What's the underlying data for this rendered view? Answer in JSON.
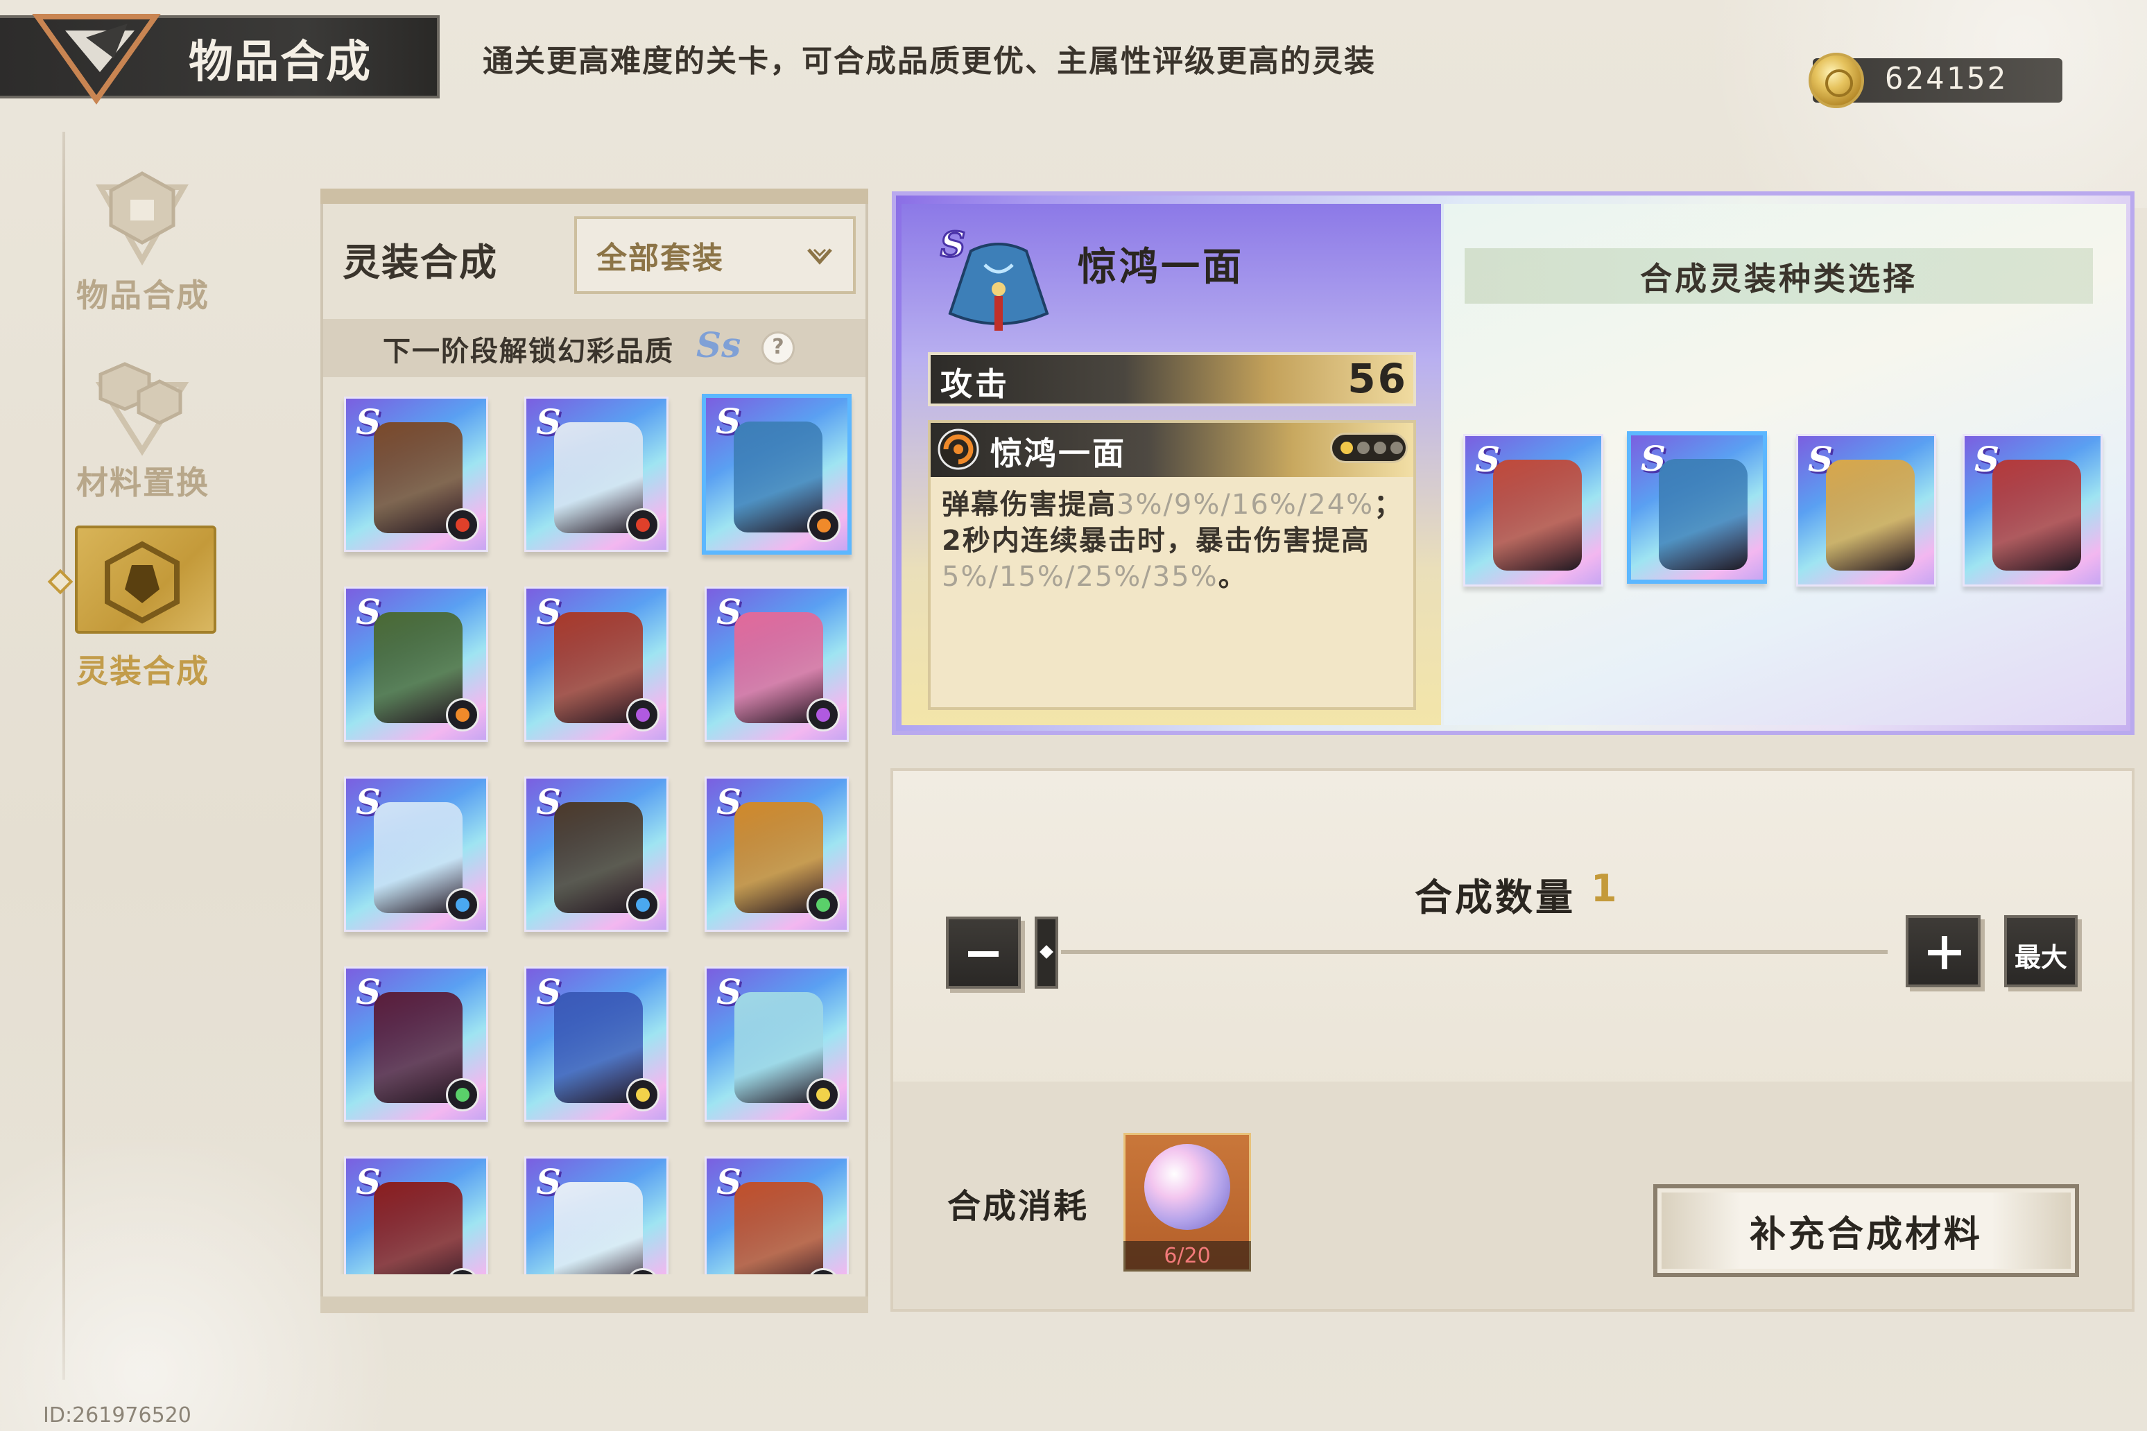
{
  "header": {
    "title": "物品合成",
    "tip": "通关更高难度的关卡，可合成品质更优、主属性评级更高的灵装",
    "currency_value": "624152",
    "currency_icon": "gold-coin-icon"
  },
  "nav": {
    "items": [
      {
        "label": "物品合成",
        "icon": "item-synthesis-icon",
        "active": false
      },
      {
        "label": "材料置换",
        "icon": "material-exchange-icon",
        "active": false
      },
      {
        "label": "灵装合成",
        "icon": "equipment-synthesis-icon",
        "active": true
      }
    ]
  },
  "list": {
    "title": "灵装合成",
    "filter": "全部套装",
    "unlock_text": "下一阶段解锁幻彩品质",
    "unlock_badge": "Ss",
    "items": [
      {
        "grade": "S",
        "item": "fur-collar-coat",
        "badge": "red-set-icon"
      },
      {
        "grade": "S",
        "item": "white-blue-cloak",
        "badge": "red-set-icon"
      },
      {
        "grade": "S",
        "item": "jinghong-cape",
        "badge": "orange-set-icon",
        "selected": true
      },
      {
        "grade": "S",
        "item": "green-military-jacket",
        "badge": "orange-set-icon"
      },
      {
        "grade": "S",
        "item": "red-hooded-robe",
        "badge": "purple-set-icon"
      },
      {
        "grade": "S",
        "item": "pink-frilled-dress",
        "badge": "purple-set-icon"
      },
      {
        "grade": "S",
        "item": "white-cape",
        "badge": "blue-set-icon"
      },
      {
        "grade": "S",
        "item": "brown-hat-coat",
        "badge": "blue-set-icon"
      },
      {
        "grade": "S",
        "item": "orange-long-coat",
        "badge": "green-set-icon"
      },
      {
        "grade": "S",
        "item": "dark-wing-cloak",
        "badge": "green-set-icon"
      },
      {
        "grade": "S",
        "item": "blue-white-robe",
        "badge": "yellow-set-icon"
      },
      {
        "grade": "S",
        "item": "cyan-mecha-wings",
        "badge": "yellow-set-icon"
      },
      {
        "grade": "S",
        "item": "red-dark-armor",
        "badge": "white-set-icon"
      },
      {
        "grade": "S",
        "item": "white-lab-coat",
        "badge": "white-set-icon"
      },
      {
        "grade": "S",
        "item": "flame-armor",
        "badge": "white-set-icon"
      }
    ]
  },
  "detail": {
    "name": "惊鸿一面",
    "stat_label": "攻击",
    "stat_value": "56",
    "effect_name": "惊鸿一面",
    "effect_desc": [
      {
        "text": "弹幕伤害提高",
        "dim": false
      },
      {
        "text": "3%/9%/16%/24%",
        "dim": true
      },
      {
        "text": "；2秒内连续暴击时，暴击伤害提高",
        "dim": false
      },
      {
        "text": "5%/15%/25%/35%",
        "dim": true
      },
      {
        "text": "。",
        "dim": false
      }
    ]
  },
  "type_select": {
    "title": "合成灵装种类选择",
    "types": [
      {
        "grade": "S",
        "item": "headdress",
        "selected": false
      },
      {
        "grade": "S",
        "item": "cape",
        "selected": true
      },
      {
        "grade": "S",
        "item": "necklace",
        "selected": false
      },
      {
        "grade": "S",
        "item": "spear",
        "selected": false
      }
    ]
  },
  "quantity": {
    "label": "合成数量",
    "value": "1",
    "max_label": "最大"
  },
  "cost": {
    "label": "合成消耗",
    "count": "6/20",
    "item_icon": "moon-orb-icon"
  },
  "supply_button": "补充合成材料",
  "user_id": "ID:261976520"
}
